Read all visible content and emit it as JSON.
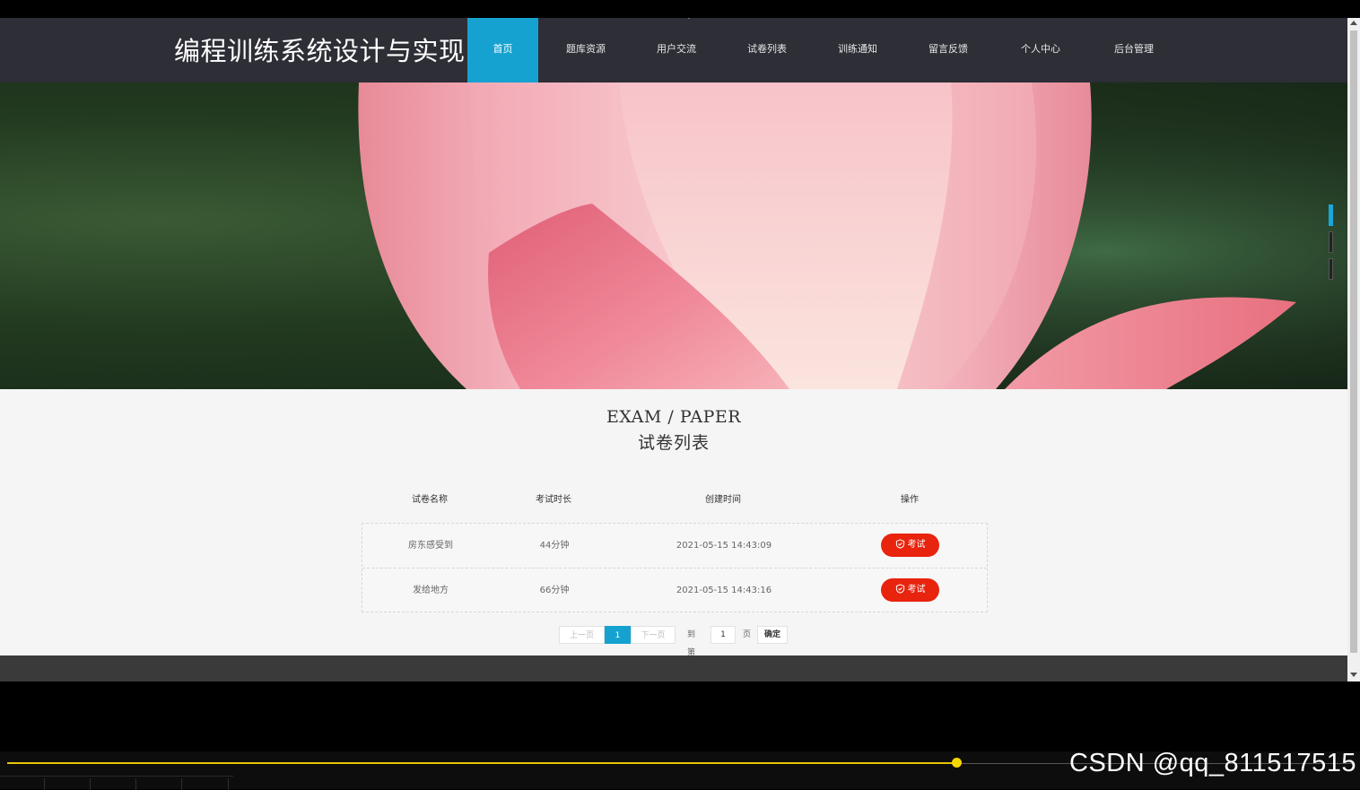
{
  "site_title": "编程训练系统设计与实现",
  "nav": [
    {
      "label": "首页",
      "active": true
    },
    {
      "label": "题库资源"
    },
    {
      "label": "用户交流"
    },
    {
      "label": "试卷列表"
    },
    {
      "label": "训练通知"
    },
    {
      "label": "留言反馈"
    },
    {
      "label": "个人中心"
    },
    {
      "label": "后台管理"
    }
  ],
  "section": {
    "title_en": "EXAM / PAPER",
    "title_cn": "试卷列表"
  },
  "table": {
    "headers": [
      "试卷名称",
      "考试时长",
      "创建时间",
      "操作"
    ],
    "rows": [
      {
        "name": "房东感受到",
        "duration": "44分钟",
        "created": "2021-05-15 14:43:09",
        "action": "考试"
      },
      {
        "name": "发给地方",
        "duration": "66分钟",
        "created": "2021-05-15 14:43:16",
        "action": "考试"
      }
    ]
  },
  "pagination": {
    "prev": "上一页",
    "current": "1",
    "next": "下一页",
    "goto_prefix": "到第",
    "page_input": "1",
    "goto_suffix": "页",
    "confirm": "确定"
  },
  "colors": {
    "header_bg": "#2d2e36",
    "accent": "#16a2d0",
    "exam_button": "#e8230e",
    "progress": "#e7c400"
  },
  "video_progress": 0.705,
  "watermark": "CSDN @qq_811517515"
}
